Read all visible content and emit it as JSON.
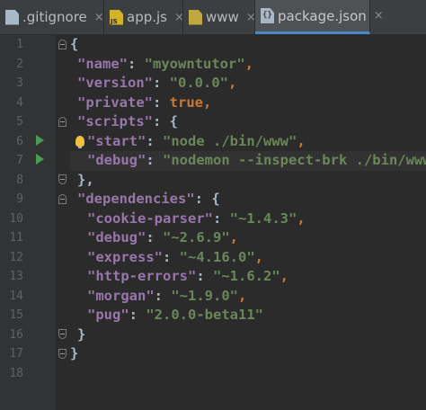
{
  "tabs": [
    {
      "label": ".gitignore",
      "icon": "file-icon",
      "active": false
    },
    {
      "label": "app.js",
      "icon": "js-file-icon",
      "active": false
    },
    {
      "label": "www",
      "icon": "www-file-icon",
      "active": false
    },
    {
      "label": "package.json",
      "icon": "json-file-icon",
      "active": true
    }
  ],
  "close_glyph": "×",
  "line_numbers": [
    "1",
    "2",
    "3",
    "4",
    "5",
    "6",
    "7",
    "8",
    "9",
    "10",
    "11",
    "12",
    "13",
    "14",
    "15",
    "16",
    "17",
    "18"
  ],
  "code": {
    "l1": {
      "brace": "{"
    },
    "l2": {
      "key": "\"name\"",
      "colon": ": ",
      "value": "\"myowntutor\"",
      "comma": ","
    },
    "l3": {
      "key": "\"version\"",
      "colon": ": ",
      "value": "\"0.0.0\"",
      "comma": ","
    },
    "l4": {
      "key": "\"private\"",
      "colon": ": ",
      "value": "true",
      "comma": ","
    },
    "l5": {
      "key": "\"scripts\"",
      "colon": ": ",
      "brace": "{"
    },
    "l6": {
      "key": "\"start\"",
      "colon": ": ",
      "value": "\"node ./bin/www\"",
      "comma": ","
    },
    "l7": {
      "key": "\"debug\"",
      "colon": ": ",
      "value": "\"nodemon --inspect-brk ./bin/www\""
    },
    "l8": {
      "brace": "},"
    },
    "l9": {
      "key": "\"dependencies\"",
      "colon": ": ",
      "brace": "{"
    },
    "l10": {
      "key": "\"cookie-parser\"",
      "colon": ": ",
      "value": "\"~1.4.3\"",
      "comma": ","
    },
    "l11": {
      "key": "\"debug\"",
      "colon": ": ",
      "value": "\"~2.6.9\"",
      "comma": ","
    },
    "l12": {
      "key": "\"express\"",
      "colon": ": ",
      "value": "\"~4.16.0\"",
      "comma": ","
    },
    "l13": {
      "key": "\"http-errors\"",
      "colon": ": ",
      "value": "\"~1.6.2\"",
      "comma": ","
    },
    "l14": {
      "key": "\"morgan\"",
      "colon": ": ",
      "value": "\"~1.9.0\"",
      "comma": ","
    },
    "l15": {
      "key": "\"pug\"",
      "colon": ": ",
      "value": "\"2.0.0-beta11\""
    },
    "l16": {
      "brace": "}"
    },
    "l17": {
      "brace": "}"
    }
  },
  "colors": {
    "background": "#2b2b2b",
    "key": "#9876aa",
    "string": "#6a8759",
    "keyword": "#cc7832",
    "punctuation": "#a9b7c6",
    "run_icon": "#499c54",
    "active_tab_underline": "#4a88c7"
  }
}
